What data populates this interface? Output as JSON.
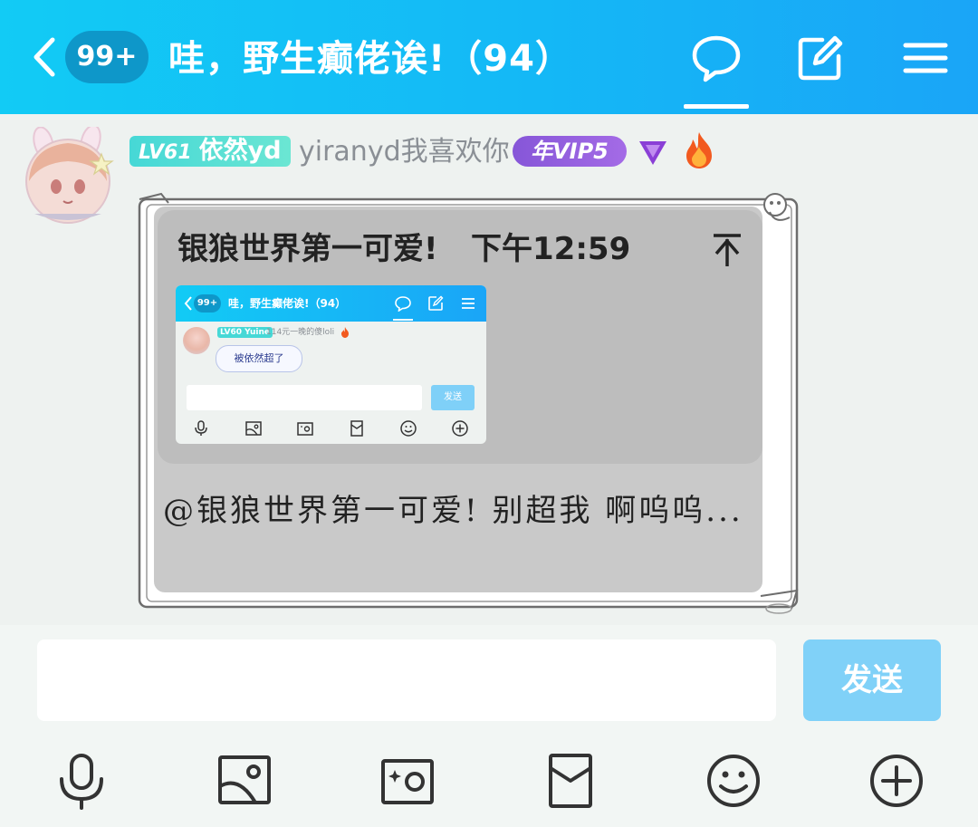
{
  "header": {
    "unread_badge": "99+",
    "title": "哇，野生癫佬诶!（94）",
    "icons": [
      "chevron-left-icon",
      "chat-bubble-icon",
      "edit-icon",
      "menu-icon"
    ],
    "colors": {
      "gradient_start": "#12cbf5",
      "gradient_end": "#1aa5f7"
    }
  },
  "message": {
    "level": "LV61",
    "nickname": "依然yd",
    "signature": "yiranyd我喜欢你",
    "vip": "年VIP5",
    "reply": {
      "quoted_user": "银狼世界第一可爱!",
      "time": "下午12:59",
      "arrow_icon": "arrow-up-icon",
      "embedded_screenshot": {
        "unread_badge": "99+",
        "title": "哇，野生癫佬诶!（94）",
        "level": "LV60",
        "nickname": "Yuine",
        "signature": "114元一晚的傻loli",
        "message": "被依然超了",
        "send_label": "发送"
      }
    },
    "text": "@银狼世界第一可爱!  别超我 啊呜呜..."
  },
  "input": {
    "value": "",
    "placeholder": "",
    "send_label": "发送"
  },
  "toolbar": {
    "icons": [
      "microphone-icon",
      "image-icon",
      "camera-icon",
      "red-packet-icon",
      "emoji-icon",
      "plus-circle-icon"
    ]
  },
  "colors": {
    "send_button": "#80d1f8",
    "level_badge": "#46d8d6",
    "vip_badge": "#8656d8"
  }
}
